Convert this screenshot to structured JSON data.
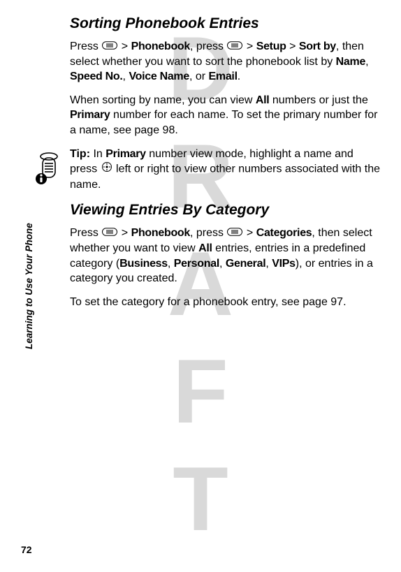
{
  "watermark": "DRAFT",
  "side_label": "Learning to Use Your Phone",
  "page_number": "72",
  "section1": {
    "title": "Sorting Phonebook Entries",
    "p1_a": "Press ",
    "p1_b": " > ",
    "kw_phonebook": "Phonebook",
    "p1_c": ", press ",
    "p1_d": " > ",
    "kw_setup": "Setup",
    "p1_e": " > ",
    "kw_sortby": "Sort by",
    "p1_f": ", then select whether you want to sort the phonebook list by ",
    "kw_name": "Name",
    "p1_g": ", ",
    "kw_speed": "Speed No.",
    "p1_h": ", ",
    "kw_voice": "Voice Name",
    "p1_i": ", or ",
    "kw_email": "Email",
    "p1_j": ".",
    "p2_a": "When sorting by name, you can view ",
    "kw_all": "All",
    "p2_b": " numbers or just the ",
    "kw_primary": "Primary",
    "p2_c": " number for each name. To set the primary number for a name, see page 98.",
    "tip_label": "Tip:",
    "tip_a": " In ",
    "tip_kw_primary": "Primary",
    "tip_b": " number view mode, highlight a name and press ",
    "tip_c": " left or right to view other numbers associated with the name."
  },
  "section2": {
    "title": "Viewing Entries By Category",
    "p1_a": "Press ",
    "p1_b": " > ",
    "kw_phonebook": "Phonebook",
    "p1_c": ", press ",
    "p1_d": " > ",
    "kw_categories": "Categories",
    "p1_e": ", then select whether you want to view ",
    "kw_all": "All",
    "p1_f": " entries, entries in a predefined category (",
    "kw_business": "Business",
    "p1_g": ", ",
    "kw_personal": "Personal",
    "p1_h": ", ",
    "kw_general": "General",
    "p1_i": ", ",
    "kw_vips": "VIPs",
    "p1_j": "), or entries in a category you created.",
    "p2": "To set the category for a phonebook entry, see page 97."
  }
}
